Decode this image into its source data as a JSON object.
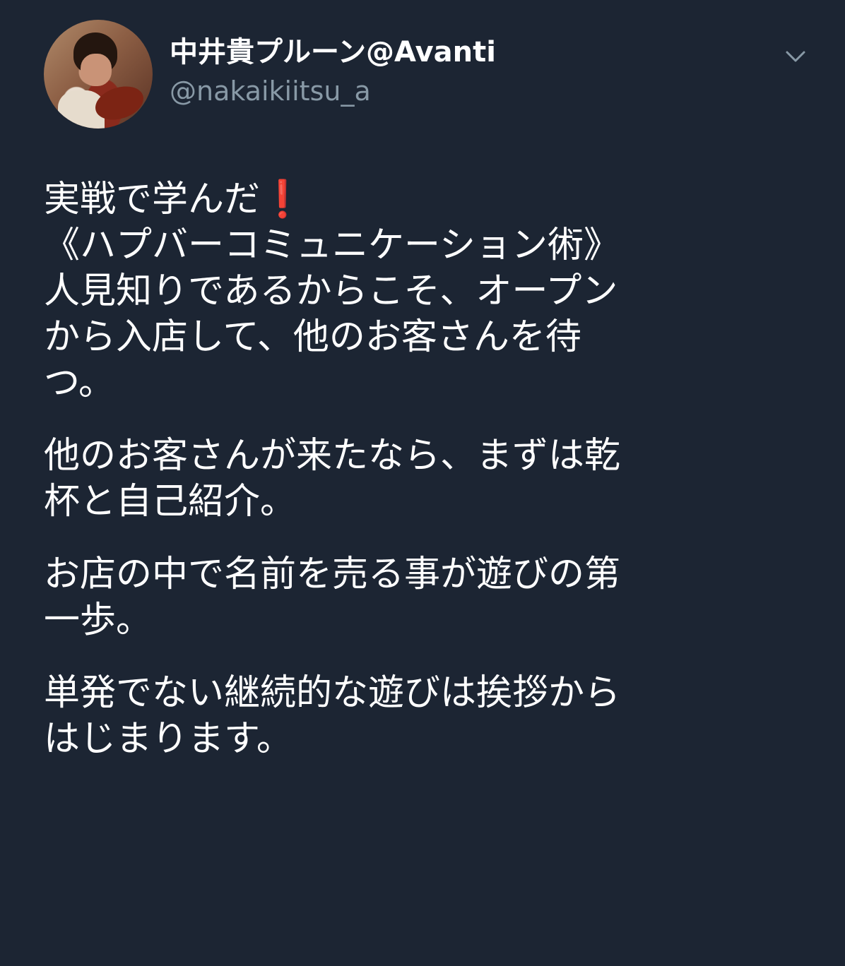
{
  "author": {
    "display_name": "中井貴プルーン@Avanti",
    "handle": "@nakaikiitsu_a"
  },
  "tweet": {
    "paragraphs": [
      [
        "実戦で学んだ",
        "《ハプバーコミュニケーション術》",
        "人見知りであるからこそ、オープン",
        "から入店して、他のお客さんを待",
        "つ。"
      ],
      [
        "他のお客さんが来たなら、まずは乾",
        "杯と自己紹介。"
      ],
      [
        "お店の中で名前を売る事が遊びの第",
        "一歩。"
      ],
      [
        "単発でない継続的な遊びは挨拶から",
        "はじまります。"
      ]
    ],
    "emoji": "❗"
  },
  "icons": {
    "menu": "chevron-down-icon"
  },
  "colors": {
    "background": "#1c2533",
    "text": "#ffffff",
    "secondary_text": "#8899a6",
    "emoji_red": "#e0262e"
  }
}
